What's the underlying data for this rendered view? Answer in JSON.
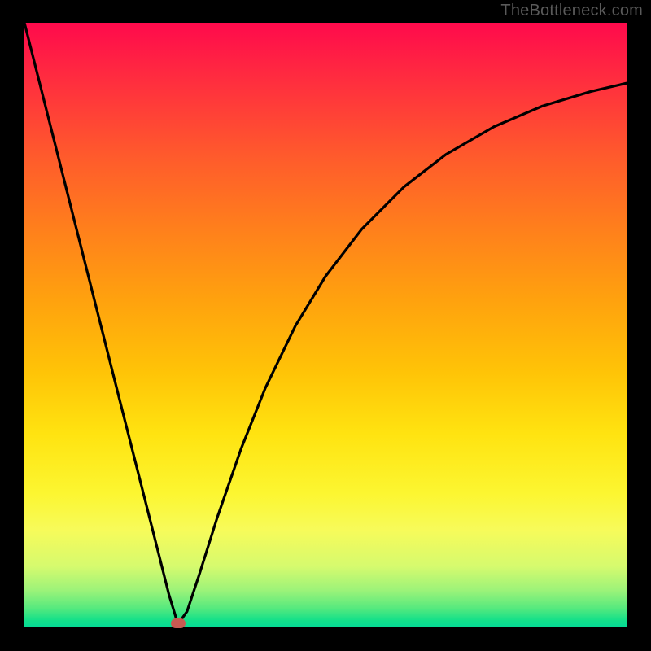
{
  "watermark": "TheBottleneck.com",
  "chart_data": {
    "type": "line",
    "title": "",
    "xlabel": "",
    "ylabel": "",
    "xlim": [
      0,
      100
    ],
    "ylim": [
      0,
      100
    ],
    "grid": false,
    "legend": false,
    "series": [
      {
        "name": "bottleneck-curve",
        "x": [
          0,
          4,
          8,
          12,
          16,
          20,
          24,
          25.5,
          27,
          29,
          32,
          36,
          40,
          45,
          50,
          56,
          63,
          70,
          78,
          86,
          94,
          100
        ],
        "y": [
          100,
          84.2,
          68.4,
          52.6,
          36.8,
          21.1,
          5.3,
          0.4,
          2.5,
          8.5,
          18.0,
          29.5,
          39.5,
          49.8,
          58.0,
          65.8,
          72.8,
          78.2,
          82.8,
          86.2,
          88.6,
          90.0
        ]
      }
    ],
    "marker": {
      "x": 25.5,
      "y": 0.5,
      "color": "#c85a52"
    },
    "background_gradient": {
      "top": "#ff0a4c",
      "mid": "#ffe310",
      "bottom": "#06db95"
    }
  }
}
